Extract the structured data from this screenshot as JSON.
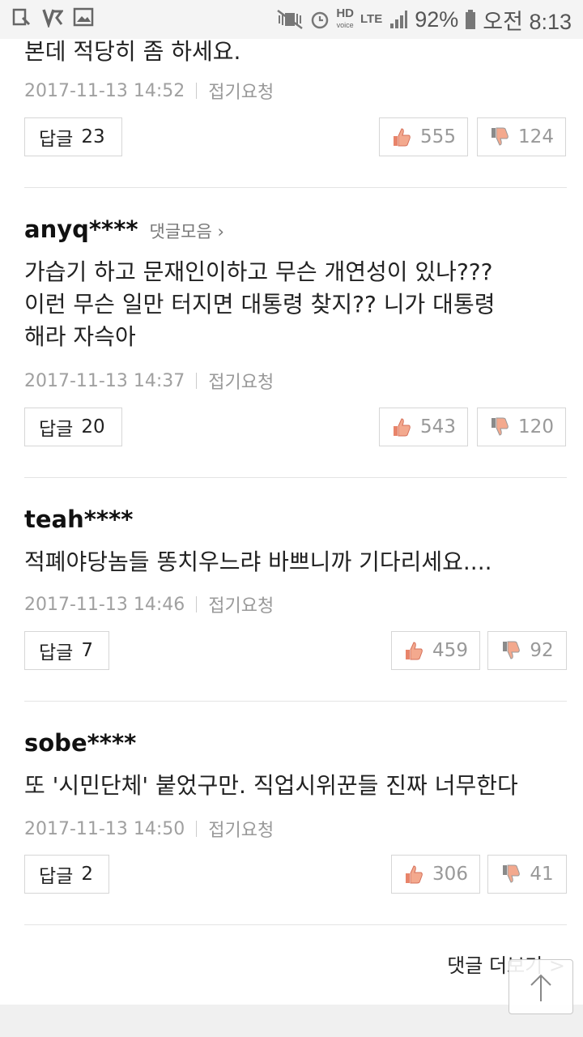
{
  "status_bar": {
    "network_label": "HD",
    "network_sub": "voice",
    "lte_label": "LTE",
    "battery": "92%",
    "time": "오전 8:13"
  },
  "partial_comment": {
    "text": "본데 적당히 좀 하세요.",
    "date": "2017-11-13 14:52",
    "fold": "접기요청",
    "reply_label": "답글",
    "reply_count": "23",
    "likes": "555",
    "dislikes": "124"
  },
  "comments": [
    {
      "nickname": "anyq****",
      "collection_link": "댓글모음",
      "lines": [
        "가습기 하고 문재인이하고 무슨 개연성이 있나???",
        "이런 무슨 일만 터지면 대통령 찾지?? 니가 대통령",
        "해라 자슥아"
      ],
      "date": "2017-11-13 14:37",
      "fold": "접기요청",
      "reply_label": "답글",
      "reply_count": "20",
      "likes": "543",
      "dislikes": "120"
    },
    {
      "nickname": "teah****",
      "lines": [
        "적폐야당놈들 똥치우느랴 바쁘니까 기다리세요...."
      ],
      "date": "2017-11-13 14:46",
      "fold": "접기요청",
      "reply_label": "답글",
      "reply_count": "7",
      "likes": "459",
      "dislikes": "92"
    },
    {
      "nickname": "sobe****",
      "lines": [
        "또 '시민단체' 붙었구만. 직업시위꾼들 진짜 너무한다"
      ],
      "date": "2017-11-13 14:50",
      "fold": "접기요청",
      "reply_label": "답글",
      "reply_count": "2",
      "likes": "306",
      "dislikes": "41"
    }
  ],
  "more_comments": "댓글 더보기 >",
  "colors": {
    "like_icon": "#e8846a",
    "dislike_icon": "#9a9a9a",
    "meta_text": "#a0a0a0",
    "border": "#d6d6d6"
  }
}
